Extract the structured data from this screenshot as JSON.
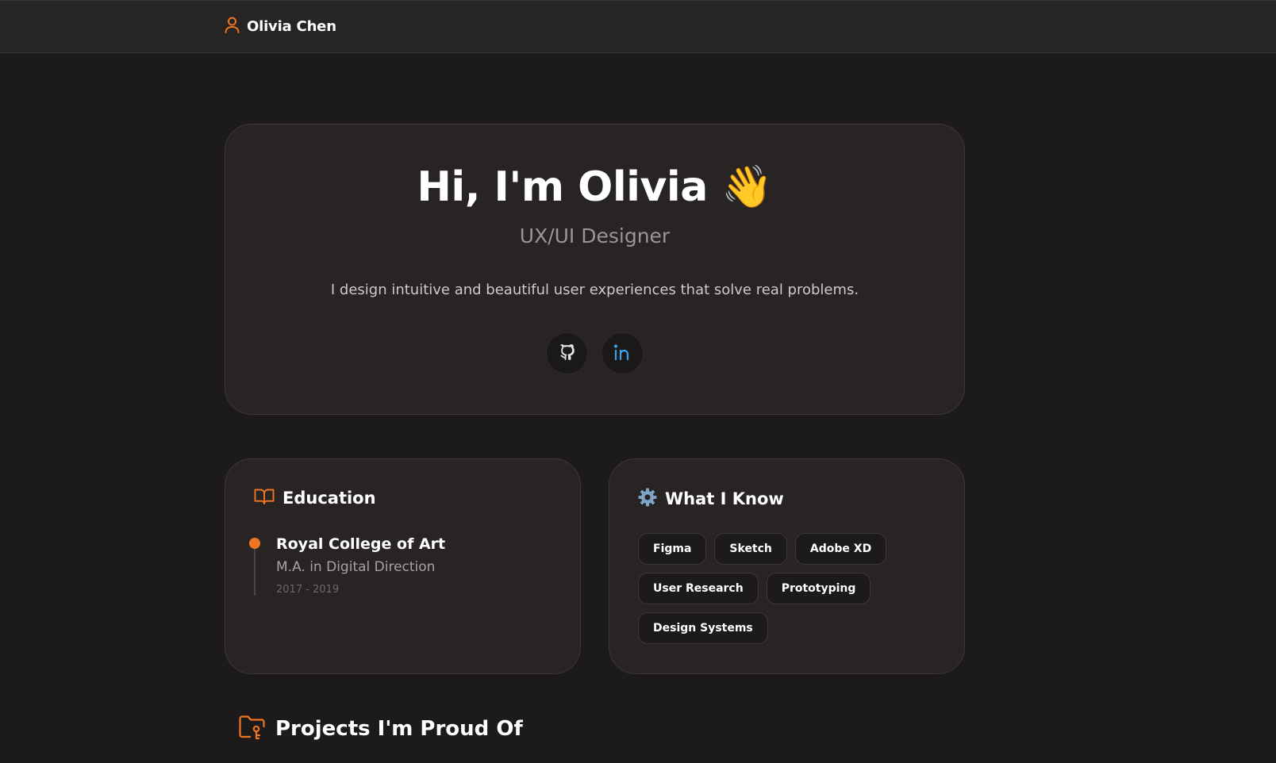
{
  "header": {
    "name": "Olivia Chen",
    "icon": "user-icon"
  },
  "hero": {
    "greeting": "Hi, I'm Olivia",
    "emoji": "👋",
    "role": "UX/UI Designer",
    "description": "I design intuitive and beautiful user experiences that solve real problems.",
    "socials": [
      {
        "icon": "github-icon"
      },
      {
        "icon": "linkedin-icon"
      }
    ]
  },
  "education": {
    "title": "Education",
    "icon": "book-open-icon",
    "items": [
      {
        "school": "Royal College of Art",
        "degree": "M.A. in Digital Direction",
        "years": "2017 - 2019"
      }
    ]
  },
  "skills": {
    "title": "What I Know",
    "icon": "gear-icon",
    "items": [
      "Figma",
      "Sketch",
      "Adobe XD",
      "User Research",
      "Prototyping",
      "Design Systems"
    ]
  },
  "projects": {
    "title": "Projects I'm Proud Of",
    "icon": "folder-code-icon"
  },
  "colors": {
    "accent": "#f07522",
    "background": "#1c1a1a",
    "card": "#282424",
    "linkedin": "#3ba2e8"
  }
}
